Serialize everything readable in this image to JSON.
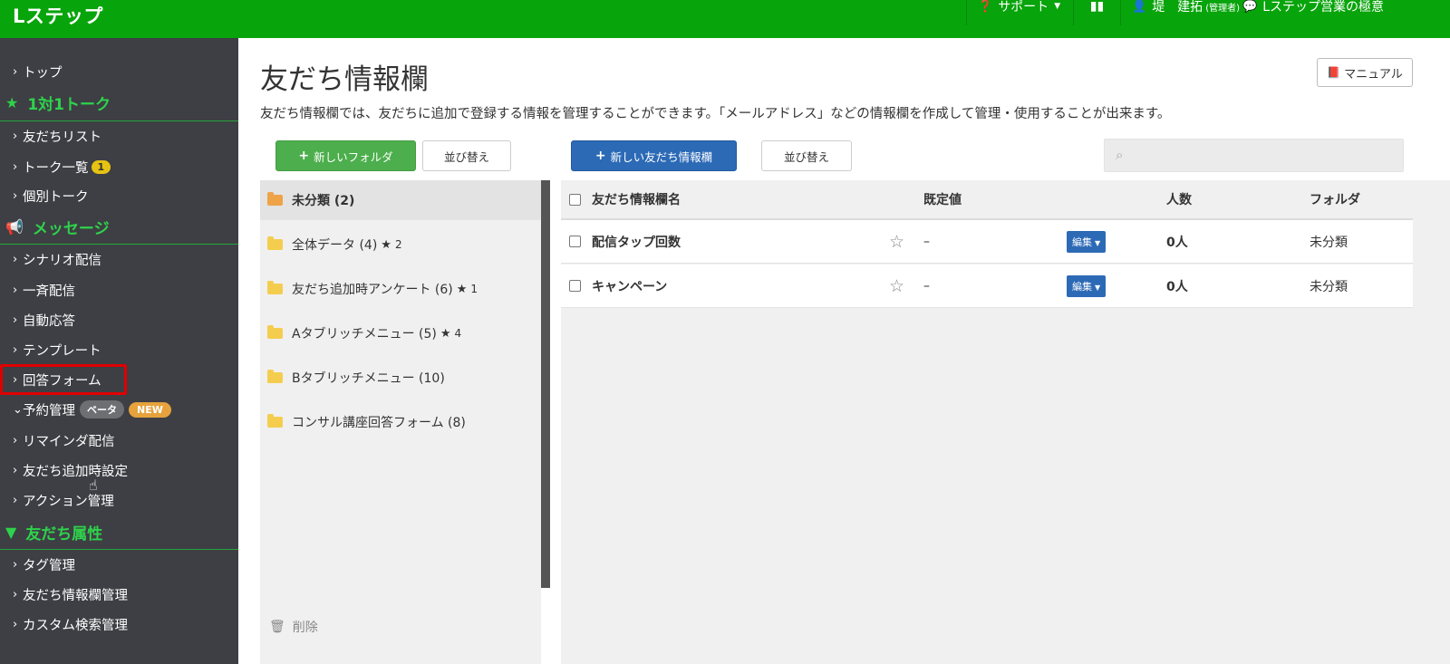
{
  "header": {
    "brand": "Lステップ",
    "support": "サポート",
    "user_name": "堤　建拓",
    "user_role": "(管理者)",
    "account": "Lステップ営業の極意"
  },
  "sidebar": {
    "top": "トップ",
    "section_talk": "1対1トーク",
    "friend_list": "友だちリスト",
    "talk_list": "トーク一覧",
    "talk_badge": "1",
    "individual_talk": "個別トーク",
    "section_message": "メッセージ",
    "scenario": "シナリオ配信",
    "broadcast": "一斉配信",
    "auto_reply": "自動応答",
    "template": "テンプレート",
    "answer_form": "回答フォーム",
    "reservation": "予約管理",
    "beta_badge": "ベータ",
    "new_badge": "NEW",
    "reminder": "リマインダ配信",
    "friend_add_setting": "友だち追加時設定",
    "action_mgmt": "アクション管理",
    "section_attr": "友だち属性",
    "tag_mgmt": "タグ管理",
    "friend_info_mgmt": "友だち情報欄管理",
    "custom_search": "カスタム検索管理"
  },
  "page": {
    "title": "友だち情報欄",
    "manual": "マニュアル",
    "description": "友だち情報欄では、友だちに追加で登録する情報を管理することができます。「メールアドレス」などの情報欄を作成して管理・使用することが出来ます。",
    "new_folder": "新しいフォルダ",
    "sort": "並び替え",
    "new_field": "新しい友だち情報欄",
    "sort2": "並び替え",
    "delete": "削除"
  },
  "folders": [
    {
      "name": "未分類 (2)",
      "star": "",
      "star_num": ""
    },
    {
      "name": "全体データ (4)",
      "star": "★",
      "star_num": "2"
    },
    {
      "name": "友だち追加時アンケート (6)",
      "star": "★",
      "star_num": "1"
    },
    {
      "name": "Aタブリッチメニュー (5)",
      "star": "★",
      "star_num": "4"
    },
    {
      "name": "Bタブリッチメニュー (10)",
      "star": "",
      "star_num": ""
    },
    {
      "name": "コンサル講座回答フォーム (8)",
      "star": "",
      "star_num": ""
    }
  ],
  "table": {
    "headers": {
      "name": "友だち情報欄名",
      "default": "既定値",
      "count": "人数",
      "folder": "フォルダ"
    },
    "edit_label": "編集",
    "rows": [
      {
        "name": "配信タップ回数",
        "default": "–",
        "count": "0人",
        "folder": "未分類"
      },
      {
        "name": "キャンペーン",
        "default": "–",
        "count": "0人",
        "folder": "未分類"
      }
    ]
  },
  "colors": {
    "brand_green": "#08a40b",
    "sidebar_bg": "#3d3f44",
    "section_green": "#2fd24b",
    "primary_blue": "#2c6ab6",
    "success_green": "#4cae4c",
    "highlight_red": "#e00000"
  },
  "icons": {
    "support": "question-circle-icon",
    "chart": "bar-chart-icon",
    "user": "user-icon",
    "chat": "comment-icon",
    "manual": "book-icon",
    "search": "search-icon",
    "delete": "trash-icon"
  }
}
